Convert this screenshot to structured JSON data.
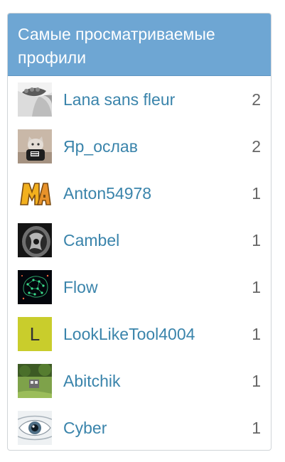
{
  "panel": {
    "title": "Самые просматриваемые профили"
  },
  "profiles": [
    {
      "name": "Lana sans fleur",
      "views": "2",
      "avatar_icon": "lana-avatar-icon"
    },
    {
      "name": "Яр_ослав",
      "views": "2",
      "avatar_icon": "cat-avatar-icon"
    },
    {
      "name": "Anton54978",
      "views": "1",
      "avatar_icon": "ma-logo-avatar-icon"
    },
    {
      "name": "Cambel",
      "views": "1",
      "avatar_icon": "tattoo-avatar-icon"
    },
    {
      "name": "Flow",
      "views": "1",
      "avatar_icon": "brain-network-avatar-icon"
    },
    {
      "name": "LookLikeTool4004",
      "views": "1",
      "avatar_letter": "L",
      "avatar_color": "#c9cd2c"
    },
    {
      "name": "Abitchik",
      "views": "1",
      "avatar_icon": "garden-avatar-icon"
    },
    {
      "name": "Cyber",
      "views": "1",
      "avatar_icon": "cyber-eye-avatar-icon"
    }
  ],
  "colors": {
    "header_bg": "#6ea6d3",
    "link": "#3a84ab",
    "count": "#666666"
  }
}
